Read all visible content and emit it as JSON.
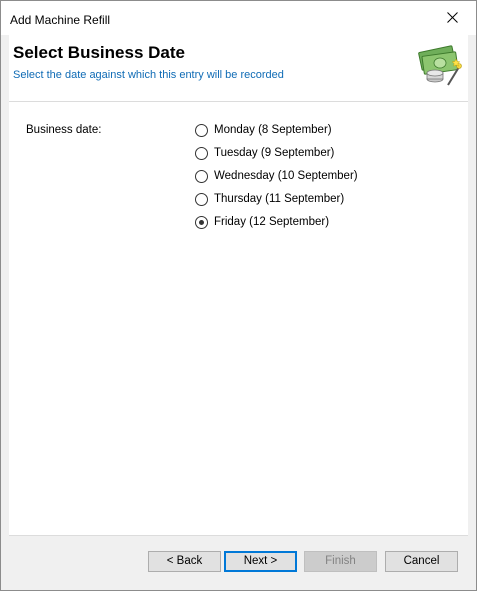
{
  "window": {
    "title": "Add Machine Refill"
  },
  "header": {
    "title": "Select Business Date",
    "subtitle": "Select the date against which this entry will be recorded",
    "icon": "money-wizard-icon"
  },
  "form": {
    "business_date_label": "Business date:",
    "options": [
      {
        "label": "Monday (8 September)",
        "checked": false
      },
      {
        "label": "Tuesday (9 September)",
        "checked": false
      },
      {
        "label": "Wednesday (10 September)",
        "checked": false
      },
      {
        "label": "Thursday (11 September)",
        "checked": false
      },
      {
        "label": "Friday (12 September)",
        "checked": true
      }
    ]
  },
  "footer": {
    "back_label": "< Back",
    "next_label": "Next >",
    "finish_label": "Finish",
    "cancel_label": "Cancel"
  },
  "colors": {
    "subtitle": "#0f6bb5",
    "default_button_border": "#0078d7"
  }
}
